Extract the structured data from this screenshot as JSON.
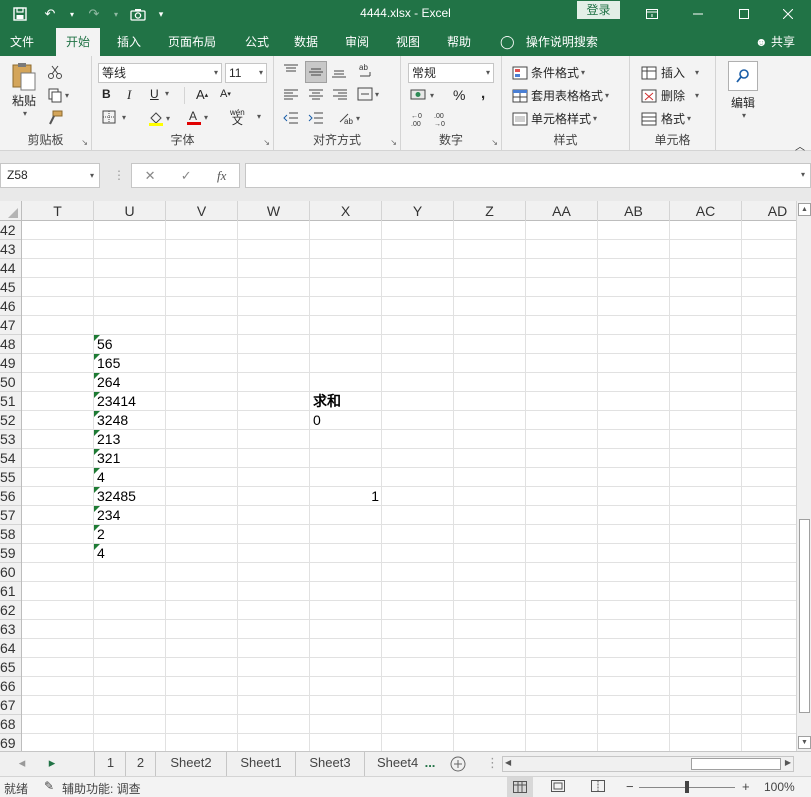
{
  "window": {
    "file_title": "4444.xlsx  -  Excel",
    "login_label": "登录",
    "qat": {
      "save_icon": "save-icon",
      "undo_icon": "undo-icon",
      "redo_icon": "redo-icon",
      "camera_icon": "camera-icon",
      "customize_icon": "customize-icon"
    },
    "controls": {
      "restore_ribbon_icon": "ribbon-display-icon",
      "minimize": "—",
      "maximize": "☐",
      "close": "✕"
    }
  },
  "ribbon_tabs": [
    "文件",
    "开始",
    "插入",
    "页面布局",
    "公式",
    "数据",
    "审阅",
    "视图",
    "帮助"
  ],
  "active_tab": "开始",
  "tell_me": "操作说明搜索",
  "share": "共享",
  "ribbon": {
    "clipboard": {
      "label": "剪贴板",
      "paste": "粘贴"
    },
    "font": {
      "label": "字体",
      "font_name": "等线",
      "font_size": "11",
      "bold": "B",
      "italic": "I",
      "underline": "U",
      "grow": "A",
      "shrink": "A",
      "phonetic": "wén"
    },
    "alignment": {
      "label": "对齐方式"
    },
    "number": {
      "label": "数字",
      "format": "常规",
      "percent": "%",
      "comma": ","
    },
    "styles": {
      "label": "样式",
      "conditional": "条件格式",
      "table": "套用表格格式",
      "cell_styles": "单元格样式"
    },
    "cells": {
      "label": "单元格",
      "insert": "插入",
      "delete": "删除",
      "format": "格式"
    },
    "editing": {
      "label": "编辑"
    }
  },
  "formula_bar": {
    "name_box": "Z58",
    "formula": ""
  },
  "columns": [
    "T",
    "U",
    "V",
    "W",
    "X",
    "Y",
    "Z",
    "AA",
    "AB",
    "AC",
    "AD"
  ],
  "rows": [
    "42",
    "43",
    "44",
    "45",
    "46",
    "47",
    "48",
    "49",
    "50",
    "51",
    "52",
    "53",
    "54",
    "55",
    "56",
    "57",
    "58",
    "59",
    "60",
    "61",
    "62",
    "63",
    "64",
    "65",
    "66",
    "67",
    "68",
    "69"
  ],
  "cells": [
    {
      "row": "48",
      "col": "U",
      "value": "56",
      "text_number": true
    },
    {
      "row": "49",
      "col": "U",
      "value": "165",
      "text_number": true
    },
    {
      "row": "50",
      "col": "U",
      "value": "264",
      "text_number": true
    },
    {
      "row": "51",
      "col": "U",
      "value": "23414",
      "text_number": true
    },
    {
      "row": "52",
      "col": "U",
      "value": "3248",
      "text_number": true
    },
    {
      "row": "53",
      "col": "U",
      "value": "213",
      "text_number": true
    },
    {
      "row": "54",
      "col": "U",
      "value": "321",
      "text_number": true
    },
    {
      "row": "55",
      "col": "U",
      "value": "4",
      "text_number": true
    },
    {
      "row": "56",
      "col": "U",
      "value": "32485",
      "text_number": true
    },
    {
      "row": "57",
      "col": "U",
      "value": "234",
      "text_number": true
    },
    {
      "row": "58",
      "col": "U",
      "value": "2",
      "text_number": true
    },
    {
      "row": "59",
      "col": "U",
      "value": "4",
      "text_number": true
    },
    {
      "row": "51",
      "col": "X",
      "value": "求和",
      "bold": true
    },
    {
      "row": "52",
      "col": "X",
      "value": "0"
    },
    {
      "row": "56",
      "col": "X",
      "value": "1",
      "align": "right"
    }
  ],
  "sheet_tabs": [
    "1",
    "2",
    "Sheet2",
    "Sheet1",
    "Sheet3",
    "Sheet4"
  ],
  "sheet_more": "...",
  "status": {
    "ready": "就绪",
    "accessibility": "辅助功能: 调查",
    "zoom": "100%"
  },
  "colors": {
    "excel_green": "#217346",
    "comment_indicator": "#1e7b34"
  }
}
